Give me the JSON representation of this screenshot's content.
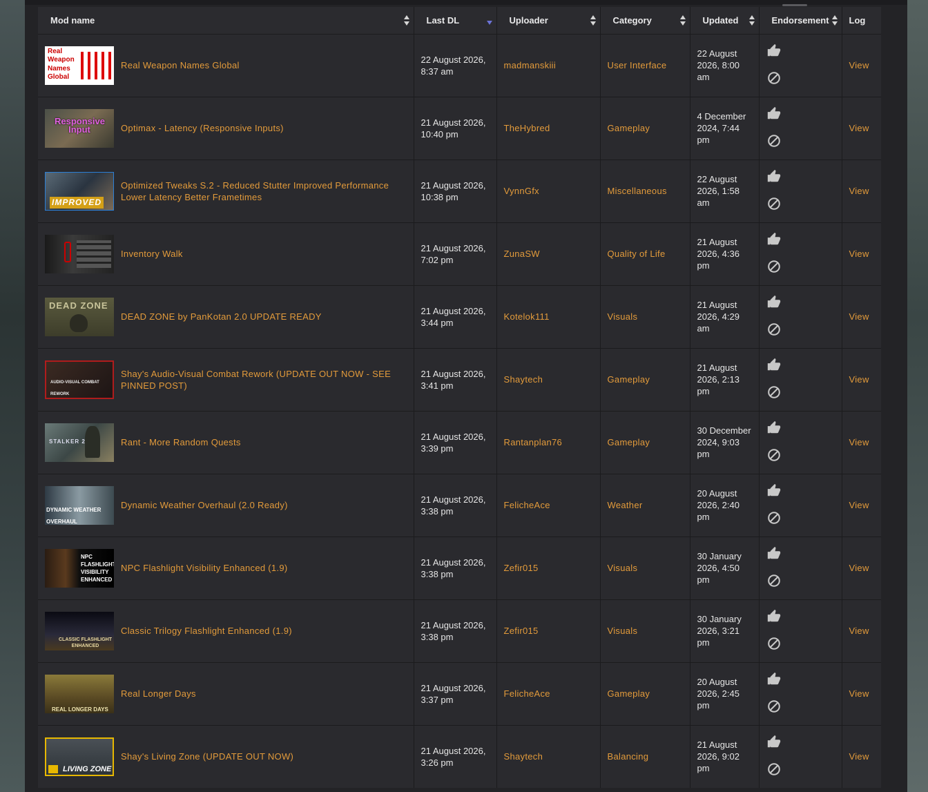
{
  "headers": {
    "mod_name": "Mod name",
    "last_dl": "Last DL",
    "uploader": "Uploader",
    "category": "Category",
    "updated": "Updated",
    "endorsement": "Endorsement",
    "log": "Log"
  },
  "colors": {
    "link": "#e39b3b",
    "sort_active": "#6c73d6"
  },
  "rows": [
    {
      "name": "Real Weapon Names Global",
      "last_dl": "22 August 2026, 8:37 am",
      "uploader": "madmanskiii",
      "category": "User Interface",
      "updated": "22 August 2026, 8:00 am",
      "log": "View",
      "thumb_text": [
        "Real",
        "Weapon",
        "Names",
        "Global"
      ]
    },
    {
      "name": "Optimax - Latency (Responsive Inputs)",
      "last_dl": "21 August 2026, 10:40 pm",
      "uploader": "TheHybred",
      "category": "Gameplay",
      "updated": "4 December 2024, 7:44 pm",
      "log": "View",
      "thumb_text": [
        "Responsive",
        "Input"
      ]
    },
    {
      "name": "Optimized Tweaks S.2 - Reduced Stutter Improved Performance Lower Latency Better Frametimes",
      "last_dl": "21 August 2026, 10:38 pm",
      "uploader": "VynnGfx",
      "category": "Miscellaneous",
      "updated": "22 August 2026, 1:58 am",
      "log": "View",
      "thumb_text": [
        "IMPROVED"
      ]
    },
    {
      "name": "Inventory Walk",
      "last_dl": "21 August 2026, 7:02 pm",
      "uploader": "ZunaSW",
      "category": "Quality of Life",
      "updated": "21 August 2026, 4:36 pm",
      "log": "View",
      "thumb_text": []
    },
    {
      "name": "DEAD ZONE by PanKotan 2.0 UPDATE READY",
      "last_dl": "21 August 2026, 3:44 pm",
      "uploader": "Kotelok111",
      "category": "Visuals",
      "updated": "21 August 2026, 4:29 am",
      "log": "View",
      "thumb_text": [
        "DEAD ZONE"
      ]
    },
    {
      "name": "Shay's Audio-Visual Combat Rework (UPDATE OUT NOW - SEE PINNED POST)",
      "last_dl": "21 August 2026, 3:41 pm",
      "uploader": "Shaytech",
      "category": "Gameplay",
      "updated": "21 August 2026, 2:13 pm",
      "log": "View",
      "thumb_text": [
        "AUDIO-VISUAL COMBAT REWORK"
      ]
    },
    {
      "name": "Rant - More Random Quests",
      "last_dl": "21 August 2026, 3:39 pm",
      "uploader": "Rantanplan76",
      "category": "Gameplay",
      "updated": "30 December 2024, 9:03 pm",
      "log": "View",
      "thumb_text": [
        "STALKER 2"
      ]
    },
    {
      "name": "Dynamic Weather Overhaul (2.0 Ready)",
      "last_dl": "21 August 2026, 3:38 pm",
      "uploader": "FelicheAce",
      "category": "Weather",
      "updated": "20 August 2026, 2:40 pm",
      "log": "View",
      "thumb_text": [
        "DYNAMIC WEATHER OVERHAUL"
      ]
    },
    {
      "name": "NPC Flashlight Visibility Enhanced (1.9)",
      "last_dl": "21 August 2026, 3:38 pm",
      "uploader": "Zefir015",
      "category": "Visuals",
      "updated": "30 January 2026, 4:50 pm",
      "log": "View",
      "thumb_text": [
        "NPC",
        "FLASHLIGHT",
        "VISIBILITY",
        "ENHANCED"
      ]
    },
    {
      "name": "Classic Trilogy Flashlight Enhanced (1.9)",
      "last_dl": "21 August 2026, 3:38 pm",
      "uploader": "Zefir015",
      "category": "Visuals",
      "updated": "30 January 2026, 3:21 pm",
      "log": "View",
      "thumb_text": [
        "CLASSIC FLASHLIGHT",
        "ENHANCED"
      ]
    },
    {
      "name": "Real Longer Days",
      "last_dl": "21 August 2026, 3:37 pm",
      "uploader": "FelicheAce",
      "category": "Gameplay",
      "updated": "20 August 2026, 2:45 pm",
      "log": "View",
      "thumb_text": [
        "REAL LONGER DAYS"
      ]
    },
    {
      "name": "Shay's Living Zone (UPDATE OUT NOW)",
      "last_dl": "21 August 2026, 3:26 pm",
      "uploader": "Shaytech",
      "category": "Balancing",
      "updated": "21 August 2026, 9:02 pm",
      "log": "View",
      "thumb_text": [
        "LIVING ZONE"
      ]
    }
  ]
}
